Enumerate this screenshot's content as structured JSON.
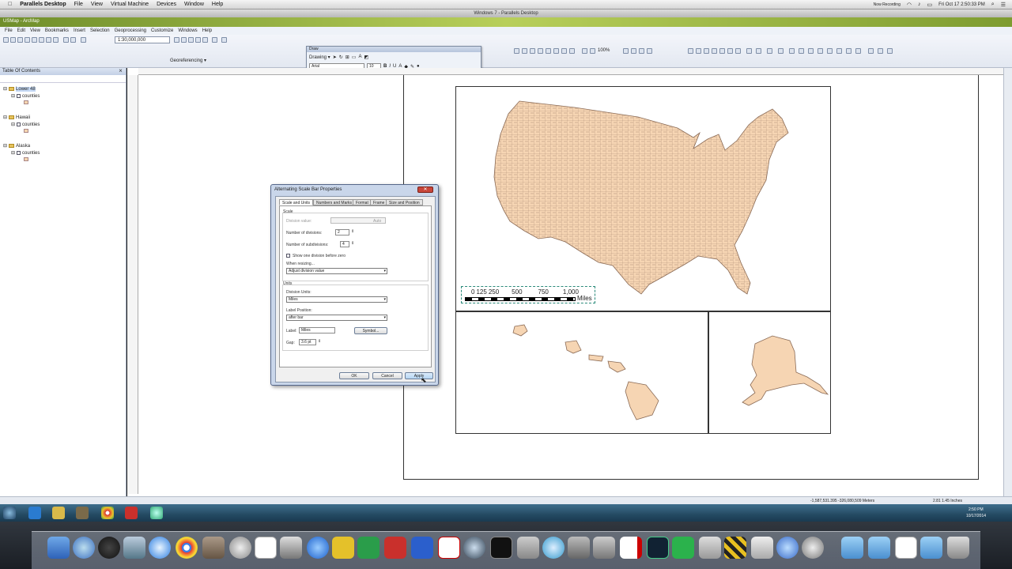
{
  "mac_menubar": {
    "apple": "",
    "app": "Parallels Desktop",
    "items": [
      "File",
      "View",
      "Virtual Machine",
      "Devices",
      "Window",
      "Help"
    ],
    "recording": "Now Recording",
    "clock": "Fri Oct 17  2:50:33 PM"
  },
  "vm_title": "Windows 7 - Parallels Desktop",
  "arcmap_title": "USMap - ArcMap",
  "arcmap_menu": [
    "File",
    "Edit",
    "View",
    "Bookmarks",
    "Insert",
    "Selection",
    "Geoprocessing",
    "Customize",
    "Windows",
    "Help"
  ],
  "toolbar": {
    "scale": "1:30,000,000",
    "georeferencing": "Georeferencing ▾",
    "zoom": "100%"
  },
  "draw_toolbar": {
    "title": "Draw",
    "drawing": "Drawing ▾",
    "font": "Arial",
    "size": "10"
  },
  "toc": {
    "title": "Table Of Contents",
    "frames": [
      {
        "name": "Lower 48",
        "layer": "counties"
      },
      {
        "name": "Hawaii",
        "layer": "counties"
      },
      {
        "name": "Alaska",
        "layer": "counties"
      }
    ]
  },
  "scalebar": {
    "labels": [
      "0",
      "125",
      "250",
      "500",
      "750",
      "1,000"
    ],
    "units": "Miles"
  },
  "dialog": {
    "title": "Alternating Scale Bar Properties",
    "close": "✕",
    "tabs": [
      "Scale and Units",
      "Numbers and Marks",
      "Format",
      "Frame",
      "Size and Position"
    ],
    "scale_group": "Scale",
    "division_value_label": "Division value:",
    "division_value": "",
    "division_value_unit": "Auto",
    "num_divisions_label": "Number of divisions:",
    "num_divisions": "2",
    "num_subdivisions_label": "Number of subdivisions:",
    "num_subdivisions": "4",
    "show_one_division": "Show one division before zero",
    "when_resizing_label": "When resizing...",
    "when_resizing": "Adjust division value",
    "units_group": "Units",
    "division_units_label": "Division Units:",
    "division_units": "Miles",
    "label_position_label": "Label Position:",
    "label_position": "after bar",
    "label_label": "Label:",
    "label_value": "Miles",
    "symbol_button": "Symbol...",
    "gap_label": "Gap:",
    "gap_value": "3.6 pt",
    "ok": "OK",
    "cancel": "Cancel",
    "apply": "Apply"
  },
  "statusbar": {
    "coords": "-1,587,531.395  -326,080,509 Meters",
    "page": "2.81  1.45 Inches"
  },
  "win_taskbar": {
    "clock_time": "2:50 PM",
    "clock_date": "10/17/2014"
  }
}
